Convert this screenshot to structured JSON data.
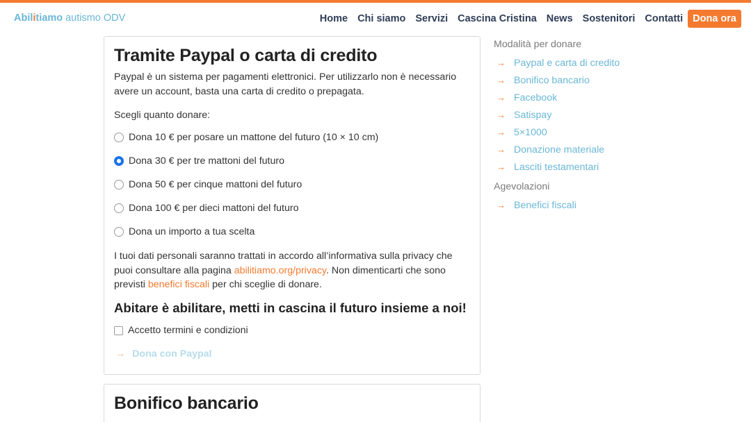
{
  "brand": {
    "part1": "Abil",
    "part2": "i",
    "part3": "tiamo",
    "part4": "autismo ODV"
  },
  "nav": {
    "items": [
      "Home",
      "Chi siamo",
      "Servizi",
      "Cascina Cristina",
      "News",
      "Sostenitori",
      "Contatti"
    ],
    "cta": "Dona ora"
  },
  "card1": {
    "title": "Tramite Paypal o carta di credito",
    "intro": "Paypal è un sistema per pagamenti elettronici. Per utilizzarlo non è necessario avere un account, basta una carta di credito o prepagata.",
    "choose_label": "Scegli quanto donare:",
    "options": [
      {
        "label": "Dona 10 € per posare un mattone del futuro (10 × 10 cm)",
        "checked": false
      },
      {
        "label": "Dona 30 € per tre mattoni del futuro",
        "checked": true
      },
      {
        "label": "Dona 50 € per cinque mattoni del futuro",
        "checked": false
      },
      {
        "label": "Dona 100 € per dieci mattoni del futuro",
        "checked": false
      },
      {
        "label": "Dona un importo a tua scelta",
        "checked": false
      }
    ],
    "privacy_text_1": "I tuoi dati personali saranno trattati in accordo all’informativa sulla privacy che puoi consultare alla pagina ",
    "privacy_link": "abilitiamo.org/privacy",
    "privacy_text_2": ". Non dimenticarti che sono previsti ",
    "benefici_link": "benefici fiscali",
    "privacy_text_3": " per chi sceglie di donare.",
    "slogan": "Abitare è abilitare, metti in cascina il futuro insieme a noi!",
    "terms_label": "Accetto termini e condizioni",
    "terms_checked": false,
    "pay_button": "Dona con Paypal"
  },
  "card2": {
    "title": "Bonifico bancario"
  },
  "sidebar": {
    "section1_title": "Modalità per donare",
    "section1_items": [
      "Paypal e carta di credito",
      "Bonifico bancario",
      "Facebook",
      "Satispay",
      "5×1000",
      "Donazione materiale",
      "Lasciti testamentari"
    ],
    "section2_title": "Agevolazioni",
    "section2_items": [
      "Benefici fiscali"
    ]
  },
  "colors": {
    "accent": "#f47a2f",
    "link_blue": "#6ab7d6",
    "nav_text": "#2f3d56",
    "radio_checked": "#1a73e8"
  }
}
